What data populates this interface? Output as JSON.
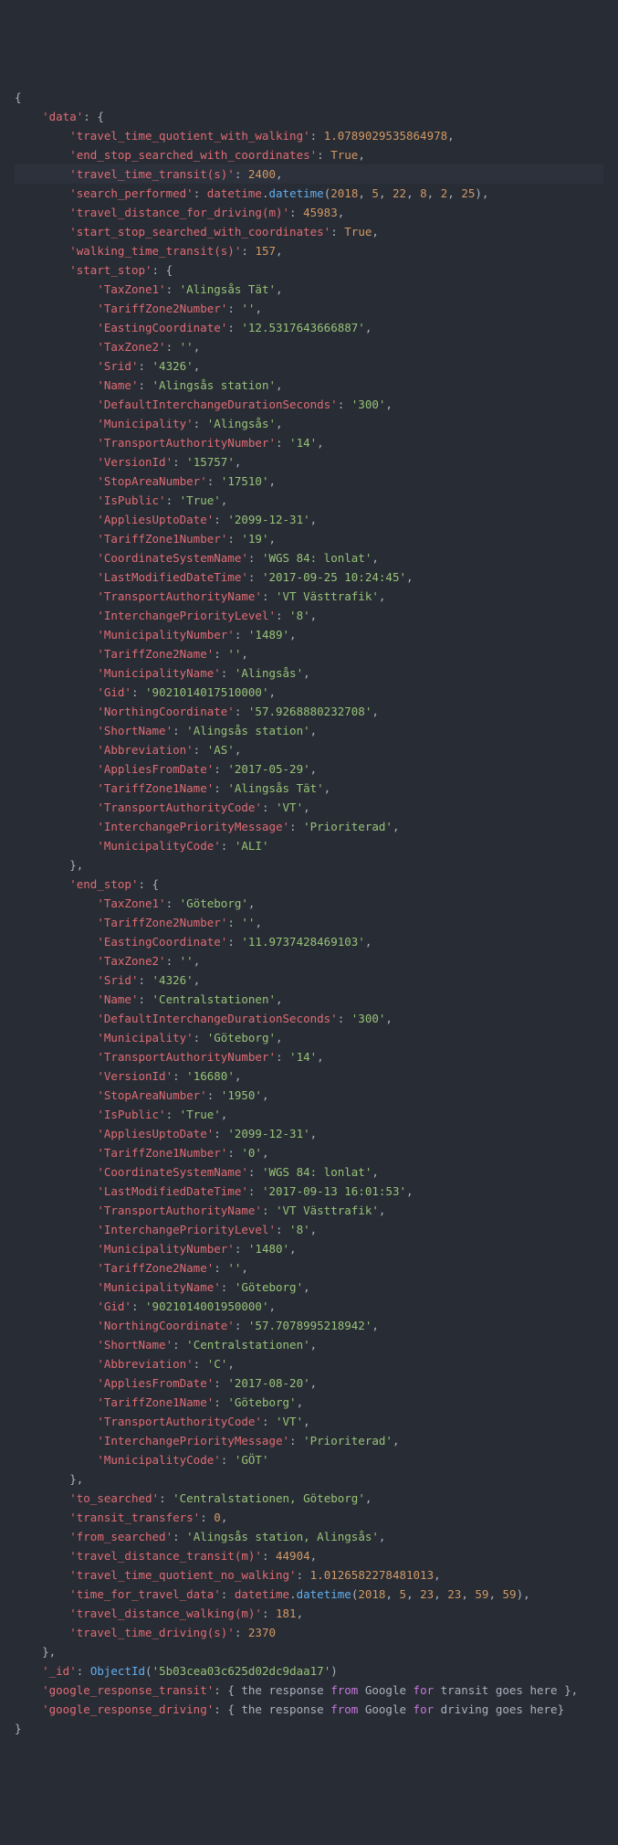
{
  "code": {
    "open_brace": "{",
    "close_brace": "}",
    "data_key": "'data'",
    "data": {
      "travel_time_quotient_with_walking": {
        "key": "'travel_time_quotient_with_walking'",
        "val": "1.0789029535864978",
        "type": "num"
      },
      "end_stop_searched_with_coordinates": {
        "key": "'end_stop_searched_with_coordinates'",
        "val": "True",
        "type": "bool"
      },
      "travel_time_transit_s": {
        "key": "'travel_time_transit(s)'",
        "val": "2400",
        "type": "num",
        "hl": true
      },
      "search_performed": {
        "key": "'search_performed'",
        "val": "datetime.datetime(2018, 5, 22, 8, 2, 25)",
        "type": "datetime",
        "args": [
          "2018",
          "5",
          "22",
          "8",
          "2",
          "25"
        ]
      },
      "travel_distance_for_driving_m": {
        "key": "'travel_distance_for_driving(m)'",
        "val": "45983",
        "type": "num"
      },
      "start_stop_searched_with_coordinates": {
        "key": "'start_stop_searched_with_coordinates'",
        "val": "True",
        "type": "bool"
      },
      "walking_time_transit_s": {
        "key": "'walking_time_transit(s)'",
        "val": "157",
        "type": "num"
      }
    },
    "start_stop_key": "'start_stop'",
    "start_stop": [
      {
        "key": "'TaxZone1'",
        "val": "'Alingsås Tät'",
        "type": "str"
      },
      {
        "key": "'TariffZone2Number'",
        "val": "''",
        "type": "str"
      },
      {
        "key": "'EastingCoordinate'",
        "val": "'12.5317643666887'",
        "type": "str"
      },
      {
        "key": "'TaxZone2'",
        "val": "''",
        "type": "str"
      },
      {
        "key": "'Srid'",
        "val": "'4326'",
        "type": "str"
      },
      {
        "key": "'Name'",
        "val": "'Alingsås station'",
        "type": "str"
      },
      {
        "key": "'DefaultInterchangeDurationSeconds'",
        "val": "'300'",
        "type": "str"
      },
      {
        "key": "'Municipality'",
        "val": "'Alingsås'",
        "type": "str"
      },
      {
        "key": "'TransportAuthorityNumber'",
        "val": "'14'",
        "type": "str"
      },
      {
        "key": "'VersionId'",
        "val": "'15757'",
        "type": "str"
      },
      {
        "key": "'StopAreaNumber'",
        "val": "'17510'",
        "type": "str"
      },
      {
        "key": "'IsPublic'",
        "val": "'True'",
        "type": "str"
      },
      {
        "key": "'AppliesUptoDate'",
        "val": "'2099-12-31'",
        "type": "str"
      },
      {
        "key": "'TariffZone1Number'",
        "val": "'19'",
        "type": "str"
      },
      {
        "key": "'CoordinateSystemName'",
        "val": "'WGS 84: lonlat'",
        "type": "str"
      },
      {
        "key": "'LastModifiedDateTime'",
        "val": "'2017-09-25 10:24:45'",
        "type": "str"
      },
      {
        "key": "'TransportAuthorityName'",
        "val": "'VT Västtrafik'",
        "type": "str"
      },
      {
        "key": "'InterchangePriorityLevel'",
        "val": "'8'",
        "type": "str"
      },
      {
        "key": "'MunicipalityNumber'",
        "val": "'1489'",
        "type": "str"
      },
      {
        "key": "'TariffZone2Name'",
        "val": "''",
        "type": "str"
      },
      {
        "key": "'MunicipalityName'",
        "val": "'Alingsås'",
        "type": "str"
      },
      {
        "key": "'Gid'",
        "val": "'9021014017510000'",
        "type": "str"
      },
      {
        "key": "'NorthingCoordinate'",
        "val": "'57.9268880232708'",
        "type": "str"
      },
      {
        "key": "'ShortName'",
        "val": "'Alingsås station'",
        "type": "str"
      },
      {
        "key": "'Abbreviation'",
        "val": "'AS'",
        "type": "str"
      },
      {
        "key": "'AppliesFromDate'",
        "val": "'2017-05-29'",
        "type": "str"
      },
      {
        "key": "'TariffZone1Name'",
        "val": "'Alingsås Tät'",
        "type": "str"
      },
      {
        "key": "'TransportAuthorityCode'",
        "val": "'VT'",
        "type": "str"
      },
      {
        "key": "'InterchangePriorityMessage'",
        "val": "'Prioriterad'",
        "type": "str"
      },
      {
        "key": "'MunicipalityCode'",
        "val": "'ALI'",
        "type": "str"
      }
    ],
    "end_stop_key": "'end_stop'",
    "end_stop": [
      {
        "key": "'TaxZone1'",
        "val": "'Göteborg'",
        "type": "str"
      },
      {
        "key": "'TariffZone2Number'",
        "val": "''",
        "type": "str"
      },
      {
        "key": "'EastingCoordinate'",
        "val": "'11.9737428469103'",
        "type": "str"
      },
      {
        "key": "'TaxZone2'",
        "val": "''",
        "type": "str"
      },
      {
        "key": "'Srid'",
        "val": "'4326'",
        "type": "str"
      },
      {
        "key": "'Name'",
        "val": "'Centralstationen'",
        "type": "str"
      },
      {
        "key": "'DefaultInterchangeDurationSeconds'",
        "val": "'300'",
        "type": "str"
      },
      {
        "key": "'Municipality'",
        "val": "'Göteborg'",
        "type": "str"
      },
      {
        "key": "'TransportAuthorityNumber'",
        "val": "'14'",
        "type": "str"
      },
      {
        "key": "'VersionId'",
        "val": "'16680'",
        "type": "str"
      },
      {
        "key": "'StopAreaNumber'",
        "val": "'1950'",
        "type": "str"
      },
      {
        "key": "'IsPublic'",
        "val": "'True'",
        "type": "str"
      },
      {
        "key": "'AppliesUptoDate'",
        "val": "'2099-12-31'",
        "type": "str"
      },
      {
        "key": "'TariffZone1Number'",
        "val": "'0'",
        "type": "str"
      },
      {
        "key": "'CoordinateSystemName'",
        "val": "'WGS 84: lonlat'",
        "type": "str"
      },
      {
        "key": "'LastModifiedDateTime'",
        "val": "'2017-09-13 16:01:53'",
        "type": "str"
      },
      {
        "key": "'TransportAuthorityName'",
        "val": "'VT Västtrafik'",
        "type": "str"
      },
      {
        "key": "'InterchangePriorityLevel'",
        "val": "'8'",
        "type": "str"
      },
      {
        "key": "'MunicipalityNumber'",
        "val": "'1480'",
        "type": "str"
      },
      {
        "key": "'TariffZone2Name'",
        "val": "''",
        "type": "str"
      },
      {
        "key": "'MunicipalityName'",
        "val": "'Göteborg'",
        "type": "str"
      },
      {
        "key": "'Gid'",
        "val": "'9021014001950000'",
        "type": "str"
      },
      {
        "key": "'NorthingCoordinate'",
        "val": "'57.7078995218942'",
        "type": "str"
      },
      {
        "key": "'ShortName'",
        "val": "'Centralstationen'",
        "type": "str"
      },
      {
        "key": "'Abbreviation'",
        "val": "'C'",
        "type": "str"
      },
      {
        "key": "'AppliesFromDate'",
        "val": "'2017-08-20'",
        "type": "str"
      },
      {
        "key": "'TariffZone1Name'",
        "val": "'Göteborg'",
        "type": "str"
      },
      {
        "key": "'TransportAuthorityCode'",
        "val": "'VT'",
        "type": "str"
      },
      {
        "key": "'InterchangePriorityMessage'",
        "val": "'Prioriterad'",
        "type": "str"
      },
      {
        "key": "'MunicipalityCode'",
        "val": "'GÖT'",
        "type": "str"
      }
    ],
    "data_tail": {
      "to_searched": {
        "key": "'to_searched'",
        "val": "'Centralstationen, Göteborg'",
        "type": "str"
      },
      "transit_transfers": {
        "key": "'transit_transfers'",
        "val": "0",
        "type": "num"
      },
      "from_searched": {
        "key": "'from_searched'",
        "val": "'Alingsås station, Alingsås'",
        "type": "str"
      },
      "travel_distance_transit_m": {
        "key": "'travel_distance_transit(m)'",
        "val": "44904",
        "type": "num"
      },
      "travel_time_quotient_no_walking": {
        "key": "'travel_time_quotient_no_walking'",
        "val": "1.0126582278481013",
        "type": "num"
      },
      "time_for_travel_data": {
        "key": "'time_for_travel_data'",
        "val": "datetime.datetime(2018, 5, 23, 23, 59, 59)",
        "type": "datetime",
        "args": [
          "2018",
          "5",
          "23",
          "23",
          "59",
          "59"
        ]
      },
      "travel_distance_walking_m": {
        "key": "'travel_distance_walking(m)'",
        "val": "181",
        "type": "num"
      },
      "travel_time_driving_s": {
        "key": "'travel_time_driving(s)'",
        "val": "2370",
        "type": "num"
      }
    },
    "id_key": "'_id'",
    "id_func": "ObjectId",
    "id_val": "'5b03cea03c625d02dc9daa17'",
    "grt_key": "'google_response_transit'",
    "grt_text_parts": [
      "{ the response ",
      "from",
      " Google ",
      "for",
      " transit goes here },"
    ],
    "grd_key": "'google_response_driving'",
    "grd_text_parts": [
      "{ the response ",
      "from",
      " Google ",
      "for",
      " driving goes here}"
    ]
  },
  "indent1": "    ",
  "indent2": "        ",
  "indent3": "            "
}
